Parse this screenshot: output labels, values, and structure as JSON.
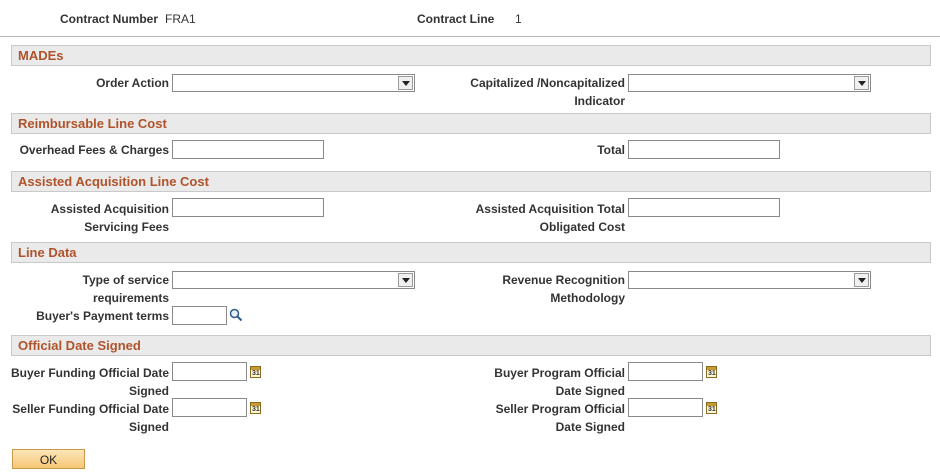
{
  "header": {
    "contract_number_label": "Contract Number",
    "contract_number_value": "FRA1",
    "contract_line_label": "Contract Line",
    "contract_line_value": "1"
  },
  "sections": {
    "mades": {
      "title": "MADEs",
      "order_action_label": "Order Action",
      "order_action_value": "",
      "capitalized_label_1": "Capitalized /Noncapitalized",
      "capitalized_label_2": "Indicator",
      "capitalized_value": ""
    },
    "reimbursable": {
      "title": "Reimbursable Line Cost",
      "overhead_label": "Overhead Fees & Charges",
      "overhead_value": "",
      "total_label": "Total",
      "total_value": ""
    },
    "assisted": {
      "title": "Assisted Acquisition Line Cost",
      "servicing_label_1": "Assisted Acquisition",
      "servicing_label_2": "Servicing Fees",
      "servicing_value": "",
      "obligated_label_1": "Assisted Acquisition Total",
      "obligated_label_2": "Obligated Cost",
      "obligated_value": ""
    },
    "line_data": {
      "title": "Line Data",
      "service_req_label_1": "Type of service",
      "service_req_label_2": "requirements",
      "service_req_value": "",
      "revenue_label_1": "Revenue Recognition",
      "revenue_label_2": "Methodology",
      "revenue_value": "",
      "payment_terms_label": "Buyer's Payment terms",
      "payment_terms_value": ""
    },
    "date_signed": {
      "title": "Official Date Signed",
      "buyer_funding_label_1": "Buyer Funding Official Date",
      "buyer_funding_label_2": "Signed",
      "buyer_funding_value": "",
      "buyer_program_label_1": "Buyer Program Official",
      "buyer_program_label_2": "Date Signed",
      "buyer_program_value": "",
      "seller_funding_label_1": "Seller Funding Official Date",
      "seller_funding_label_2": "Signed",
      "seller_funding_value": "",
      "seller_program_label_1": "Seller Program Official",
      "seller_program_label_2": "Date Signed",
      "seller_program_value": ""
    }
  },
  "icons": {
    "calendar": "calendar-icon",
    "lookup": "lookup-icon",
    "dropdown": "chevron-down-icon",
    "calendar_glyph": "31"
  },
  "buttons": {
    "ok_label": "OK"
  },
  "colors": {
    "section_title": "#b0532a",
    "section_bg": "#eaeaea",
    "button_bg": "#f6c676"
  }
}
